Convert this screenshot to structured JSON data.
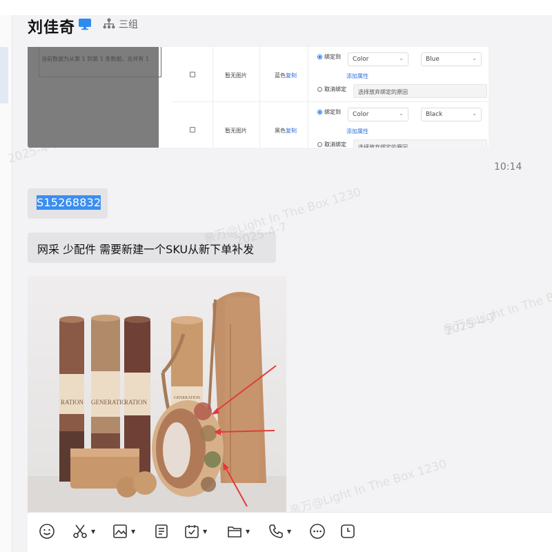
{
  "header": {
    "contact_name": "刘佳奇",
    "team": "三组"
  },
  "shared_screenshot": {
    "overlay_text": "当前数据为从第 1 到第 1 条数据，总共有 1",
    "rows": [
      {
        "image": "暂无图片",
        "color_name": "蓝色",
        "copy_link": "复制",
        "bind_option": "绑定到",
        "attribute": "Color",
        "value": "Blue",
        "add_attribute": "添加属性",
        "unbind_option": "取消绑定",
        "unbind_reason_placeholder": "选择放弃绑定的原因"
      },
      {
        "image": "暂无图片",
        "color_name": "黑色",
        "copy_link": "复制",
        "bind_option": "绑定到",
        "attribute": "Color",
        "value": "Black",
        "add_attribute": "添加属性",
        "unbind_option": "取消绑定",
        "unbind_reason_placeholder": "选择放弃绑定的原因"
      }
    ]
  },
  "messages": {
    "timestamp": "10:14",
    "sku_text": "S15268832",
    "order_note": "网采 少配件 需要新建一个SKU从新下单补发"
  },
  "photo": {
    "label_1": "RATION",
    "label_2": "GENERATIO",
    "label_3": "RATION",
    "label_4": "GENERATION"
  },
  "watermarks": {
    "name_line": "亲万@Light In The Box 1230",
    "date_line": "2025-4-7"
  },
  "toolbar": {
    "tools": [
      "emoji-icon",
      "scissors-icon",
      "image-icon",
      "document-icon",
      "calendar-check-icon",
      "folder-icon",
      "phone-icon",
      "chat-bubble-icon",
      "clock-icon"
    ]
  },
  "colors": {
    "selection": "#3b8ef0",
    "bubble": "#e4e4e7",
    "link": "#2f6fde",
    "annotation_arrow": "#e53935"
  }
}
